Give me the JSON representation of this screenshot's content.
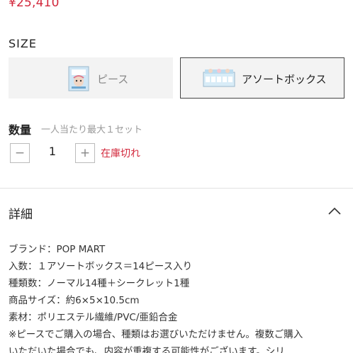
{
  "product": {
    "price": "¥25,410"
  },
  "size": {
    "label": "SIZE",
    "options": [
      {
        "label": "ピース",
        "selected": false
      },
      {
        "label": "アソートボックス",
        "selected": true
      }
    ]
  },
  "quantity": {
    "label": "数量",
    "note": "一人当たり最大１セット",
    "value": "1",
    "minus_symbol": "−",
    "plus_symbol": "+",
    "stock_status": "在庫切れ"
  },
  "details": {
    "heading": "詳細",
    "lines": [
      "ブランド：POP MART",
      "入数：１アソートボックス＝14ピース入り",
      "種類数：ノーマル14種＋シークレット1種",
      "商品サイズ：約6×5×10.5cm",
      "素材：ポリエステル繊維/PVC/亜鉛合金",
      "※ピースでご購入の場合、種類はお選びいただけません。複数ご購入",
      "いただいた場合でも、内容が重複する可能性がございます。シリ"
    ]
  },
  "colors": {
    "accent_red": "#d2283c",
    "option_bg": "#f3f3f3",
    "selected_border": "#444444"
  }
}
